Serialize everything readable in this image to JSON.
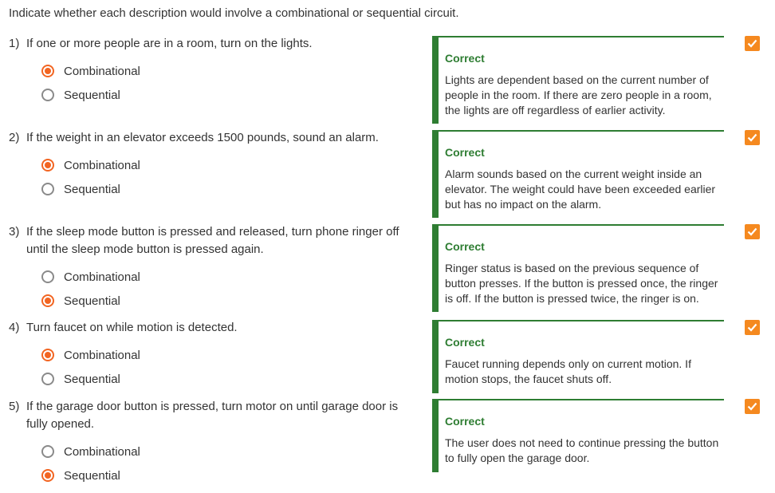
{
  "instructions": "Indicate whether each description would involve a combinational or sequential circuit.",
  "questions": [
    {
      "number": "1)",
      "text": "If one or more people are in a room, turn on the lights.",
      "options": [
        {
          "label": "Combinational",
          "selected": true
        },
        {
          "label": "Sequential",
          "selected": false
        }
      ],
      "feedback": {
        "status": "Correct",
        "text": "Lights are dependent based on the current number of people in the room. If there are zero people in a room, the lights are off regardless of earlier activity."
      }
    },
    {
      "number": "2)",
      "text": "If the weight in an elevator exceeds 1500 pounds, sound an alarm.",
      "options": [
        {
          "label": "Combinational",
          "selected": true
        },
        {
          "label": "Sequential",
          "selected": false
        }
      ],
      "feedback": {
        "status": "Correct",
        "text": "Alarm sounds based on the current weight inside an elevator. The weight could have been exceeded earlier but has no impact on the alarm."
      }
    },
    {
      "number": "3)",
      "text": "If the sleep mode button is pressed and released, turn phone ringer off until the sleep mode button is pressed again.",
      "options": [
        {
          "label": "Combinational",
          "selected": false
        },
        {
          "label": "Sequential",
          "selected": true
        }
      ],
      "feedback": {
        "status": "Correct",
        "text": "Ringer status is based on the previous sequence of button presses. If the button is pressed once, the ringer is off. If the button is pressed twice, the ringer is on."
      }
    },
    {
      "number": "4)",
      "text": "Turn faucet on while motion is detected.",
      "options": [
        {
          "label": "Combinational",
          "selected": true
        },
        {
          "label": "Sequential",
          "selected": false
        }
      ],
      "feedback": {
        "status": "Correct",
        "text": "Faucet running depends only on current motion. If motion stops, the faucet shuts off."
      }
    },
    {
      "number": "5)",
      "text": "If the garage door button is pressed, turn motor on until garage door is fully opened.",
      "options": [
        {
          "label": "Combinational",
          "selected": false
        },
        {
          "label": "Sequential",
          "selected": true
        }
      ],
      "feedback": {
        "status": "Correct",
        "text": "The user does not need to continue pressing the button to fully open the garage door."
      }
    }
  ],
  "icons": {
    "check": "check-icon"
  },
  "colors": {
    "accent": "#f26522",
    "correct": "#2e7d32",
    "check_bg": "#f5891f"
  }
}
